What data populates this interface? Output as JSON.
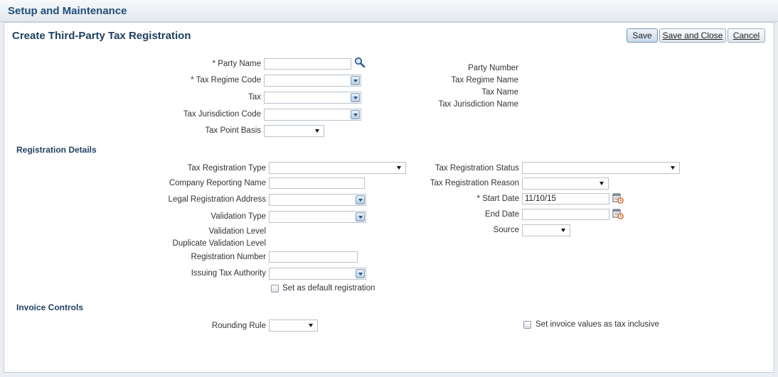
{
  "header": {
    "title": "Setup and Maintenance"
  },
  "page": {
    "title": "Create Third-Party Tax Registration"
  },
  "toolbar": {
    "save": "Save",
    "save_close": "Save and Close",
    "cancel": "Cancel"
  },
  "top": {
    "party_name": "* Party Name",
    "tax_regime_code": "* Tax Regime Code",
    "tax": "Tax",
    "tax_jurisdiction_code": "Tax Jurisdiction Code",
    "tax_point_basis": "Tax Point Basis",
    "party_number": "Party Number",
    "tax_regime_name": "Tax Regime Name",
    "tax_name": "Tax Name",
    "tax_jurisdiction_name": "Tax Jurisdiction Name"
  },
  "registration": {
    "section": "Registration Details",
    "type": "Tax Registration Type",
    "company_reporting_name": "Company Reporting Name",
    "legal_registration_address": "Legal Registration Address",
    "validation_type": "Validation Type",
    "validation_level": "Validation Level",
    "duplicate_validation_level": "Duplicate Validation Level",
    "registration_number": "Registration Number",
    "issuing_tax_authority": "Issuing Tax Authority",
    "default_registration": "Set as default registration",
    "status": "Tax Registration Status",
    "reason": "Tax Registration Reason",
    "start_date_label": "* Start Date",
    "start_date_value": "11/10/15",
    "end_date_label": "End Date",
    "source": "Source"
  },
  "invoice": {
    "section": "Invoice Controls",
    "rounding_rule": "Rounding Rule",
    "tax_inclusive": "Set invoice values as tax inclusive"
  },
  "icons": {
    "search": "search-icon",
    "calendar": "calendar-icon",
    "dropdown": "chevron-down-icon"
  }
}
